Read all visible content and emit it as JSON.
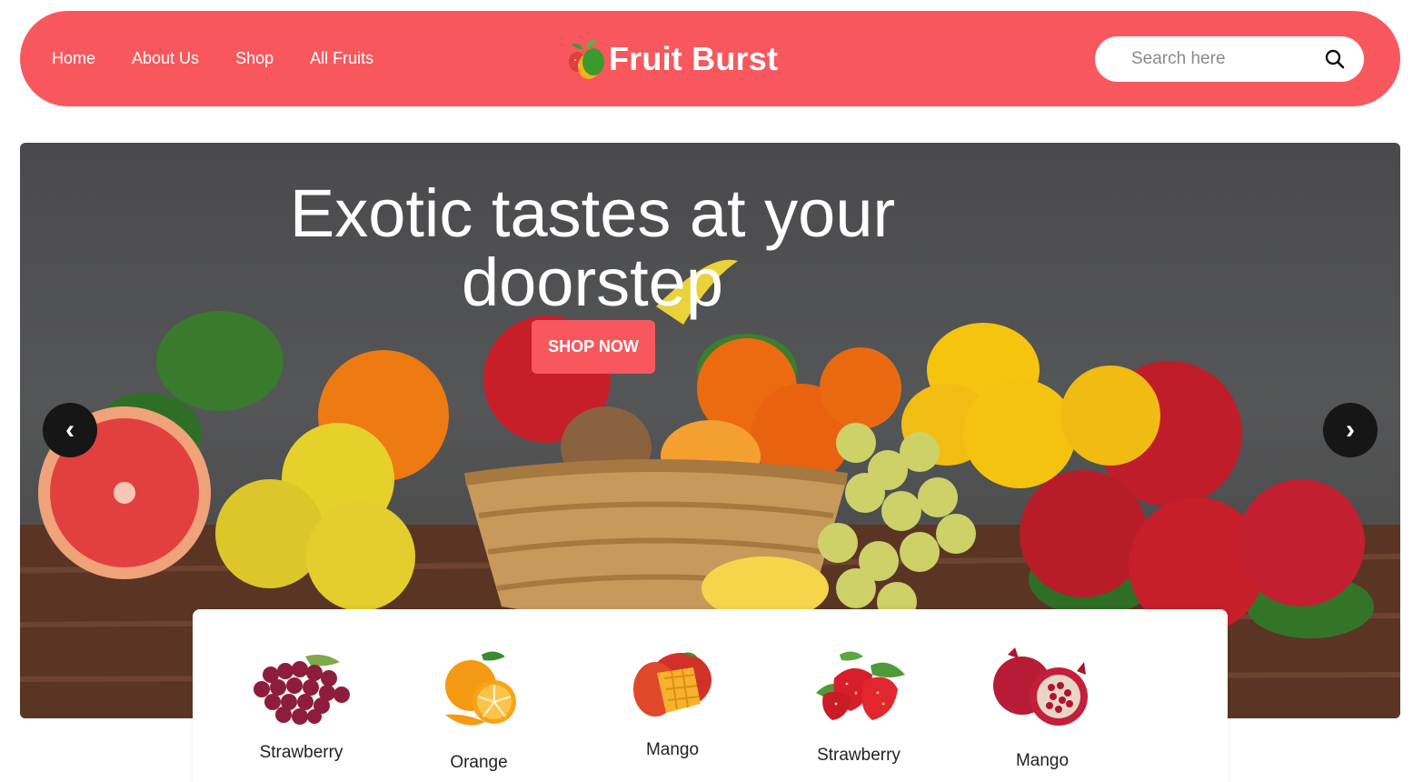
{
  "header": {
    "nav": [
      "Home",
      "About Us",
      "Shop",
      "All Fruits"
    ],
    "brand": "Fruit Burst",
    "search_placeholder": "Search here"
  },
  "hero": {
    "title": "Exotic tastes at your doorstep",
    "cta_label": "SHOP NOW",
    "prev_arrow": "‹",
    "next_arrow": "›"
  },
  "categories": [
    "Strawberry",
    "Orange",
    "Mango",
    "Strawberry",
    "Mango"
  ],
  "colors": {
    "brand": "#f8585d",
    "arrow_bg": "#161616"
  }
}
